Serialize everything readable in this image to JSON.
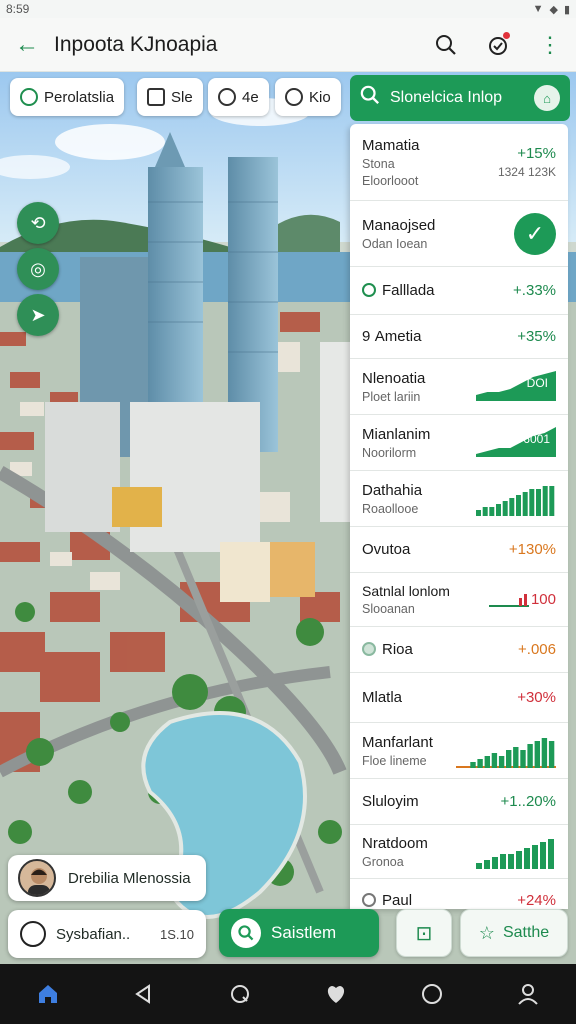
{
  "status": {
    "time": "8:59",
    "signal": "▾",
    "battery": "▮"
  },
  "app_bar": {
    "title": "Inpoota KJnoapia",
    "back_icon": "arrow-left-icon"
  },
  "chips": [
    {
      "label": "Perolatslia",
      "icon": "leaf-icon"
    },
    {
      "label": "Sle",
      "icon": "building-icon"
    },
    {
      "label": "4e",
      "icon": "tree-icon"
    },
    {
      "label": "Kio",
      "icon": "location-icon"
    }
  ],
  "search": {
    "label": "Slonelcica Inlop"
  },
  "list": [
    {
      "name": "Mamatia",
      "sub": "Stona",
      "sub2": "Eloorlooot",
      "pct": "+15%",
      "pct_color": "green",
      "meta": "1324 123K",
      "type": "text"
    },
    {
      "name": "Manaojsed",
      "sub": "Odan Ioean",
      "type": "check"
    },
    {
      "name": "Falllada",
      "pct": "+.33%",
      "pct_color": "green",
      "type": "dot"
    },
    {
      "name": "Ametia",
      "prefix": "9",
      "pct": "+35%",
      "pct_color": "green",
      "type": "prefix"
    },
    {
      "name": "Nlenoatia",
      "sub": "Ploet lariin",
      "spark_label": "DOI",
      "type": "spark_fill",
      "spark": [
        2,
        3,
        3,
        4,
        6,
        8,
        9,
        10
      ]
    },
    {
      "name": "Mianlanim",
      "sub": "Noorilorm",
      "spark_label": "T6001",
      "type": "spark_fill",
      "spark": [
        1,
        2,
        3,
        3,
        5,
        7,
        8,
        10
      ]
    },
    {
      "name": "Dathahia",
      "sub": "Roaollooe",
      "type": "spark_bar",
      "spark": [
        2,
        3,
        3,
        4,
        5,
        6,
        7,
        8,
        9,
        9,
        10,
        10
      ]
    },
    {
      "name": "Ovutoa",
      "pct": "+130%",
      "pct_color": "orange",
      "type": "plain"
    },
    {
      "name": "Satnlal lonlom",
      "sub": "Slooanan",
      "pct": "100",
      "pct_color": "red",
      "type": "spark_red"
    },
    {
      "name": "Rioa",
      "pct": "+.006",
      "pct_color": "orange",
      "type": "dot_light"
    },
    {
      "name": "Mlatla",
      "pct": "+30%",
      "pct_color": "red",
      "type": "plain"
    },
    {
      "name": "Manfarlant",
      "sub": "Floe lineme",
      "type": "spark_mixed",
      "spark": [
        2,
        3,
        4,
        5,
        4,
        6,
        7,
        6,
        8,
        9,
        10,
        9
      ]
    },
    {
      "name": "Sluloyim",
      "pct": "+1..20%",
      "pct_color": "green",
      "type": "plain"
    },
    {
      "name": "Nratdoom",
      "sub": "Gronoa",
      "type": "spark_bar",
      "spark": [
        2,
        3,
        4,
        5,
        5,
        6,
        7,
        8,
        9,
        10
      ]
    },
    {
      "name": "Paul",
      "pct": "+24%",
      "pct_color": "red",
      "type": "dot_gray"
    }
  ],
  "bottom": {
    "profile_name": "Drebilia Mlenossia",
    "radio_label": "Sysbafian..",
    "radio_value": "1S.10",
    "primary_button": "Saistlem",
    "secondary_button": "Satthe",
    "square_button_icon": "bookmark-icon"
  },
  "nav": [
    "home-icon",
    "back-icon",
    "search-icon",
    "heart-icon",
    "circle-icon",
    "profile-icon"
  ],
  "colors": {
    "accent": "#1d9a57",
    "positive": "#1d8a4e",
    "warning": "#d9771e",
    "negative": "#d0303b"
  }
}
